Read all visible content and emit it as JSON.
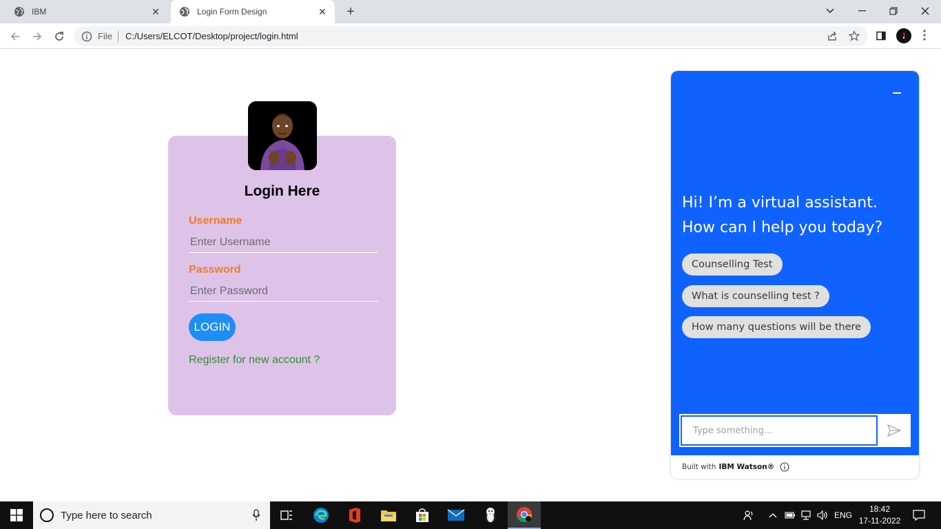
{
  "browser": {
    "tabs": [
      {
        "title": "IBM",
        "icon": "globe-icon",
        "active": false
      },
      {
        "title": "Login Form Design",
        "icon": "globe-icon",
        "active": true
      }
    ],
    "address": {
      "scheme_label": "File",
      "url": "C:/Users/ELCOT/Desktop/project/login.html"
    }
  },
  "login": {
    "title": "Login Here",
    "username_label": "Username",
    "username_placeholder": "Enter Username",
    "password_label": "Password",
    "password_placeholder": "Enter Password",
    "login_button": "LOGIN",
    "register_link": "Register for new account ?",
    "colors": {
      "card": "#dec3e9",
      "label": "#f07d23",
      "button": "#1d8ef5",
      "link": "#2f8f2f"
    }
  },
  "chat": {
    "greeting": "Hi! I’m a virtual assistant. How can I help you today?",
    "suggestions": [
      "Counselling Test",
      "What is counselling test ?",
      "How many questions will be there"
    ],
    "input_placeholder": "Type something...",
    "footer_prefix": "Built with",
    "footer_brand": "IBM Watson®",
    "colors": {
      "primary": "#0f62fe"
    }
  },
  "taskbar": {
    "search_placeholder": "Type here to search",
    "language": "ENG",
    "time": "18:42",
    "date": "17-11-2022",
    "apps": [
      "task-view",
      "edge",
      "office",
      "file-explorer",
      "store",
      "mail",
      "penguin-app",
      "chrome"
    ]
  }
}
